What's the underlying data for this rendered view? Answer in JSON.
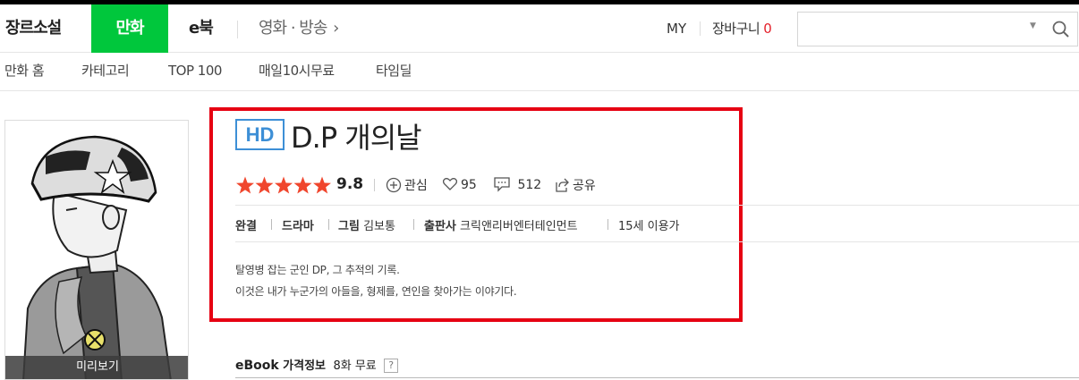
{
  "gnb": {
    "categories": [
      "장르소설",
      "만화",
      "e북",
      "영화 · 방송"
    ],
    "active_category": "만화",
    "movie_chevron": "›",
    "my": "MY",
    "cart_label": "장바구니",
    "cart_count": "0",
    "search_value": ""
  },
  "lnb": {
    "items": [
      "만화 홈",
      "카테고리",
      "TOP 100",
      "매일10시무료",
      "타임딜"
    ]
  },
  "cover": {
    "preview_label": "미리보기"
  },
  "product": {
    "badge": "HD",
    "title": "D.P 개의날",
    "rating": "9.8",
    "stars": 5,
    "interest_label": "관심",
    "likes": "95",
    "comments": "512",
    "share_label": "공유",
    "status": "완결",
    "genre": "드라마",
    "art_label": "그림",
    "artist": "김보통",
    "publisher_label": "출판사",
    "publisher": "크릭앤리버엔터테인먼트",
    "age": "15세 이용가",
    "description_lines": [
      "탈영병 잡는 군인 DP, 그 추적의 기록.",
      "이것은 내가 누군가의 아들을, 형제를, 연인을 찾아가는 이야기다."
    ]
  },
  "ebook": {
    "title_a": "eBook",
    "title_b": "가격정보",
    "free_count": "8화 무료",
    "help": "?"
  },
  "colors": {
    "brand_green": "#00c73c",
    "highlight_red": "#e60012",
    "star_red": "#f0462d",
    "hd_blue": "#3d8fd6",
    "cart_count_red": "#e4212b"
  }
}
